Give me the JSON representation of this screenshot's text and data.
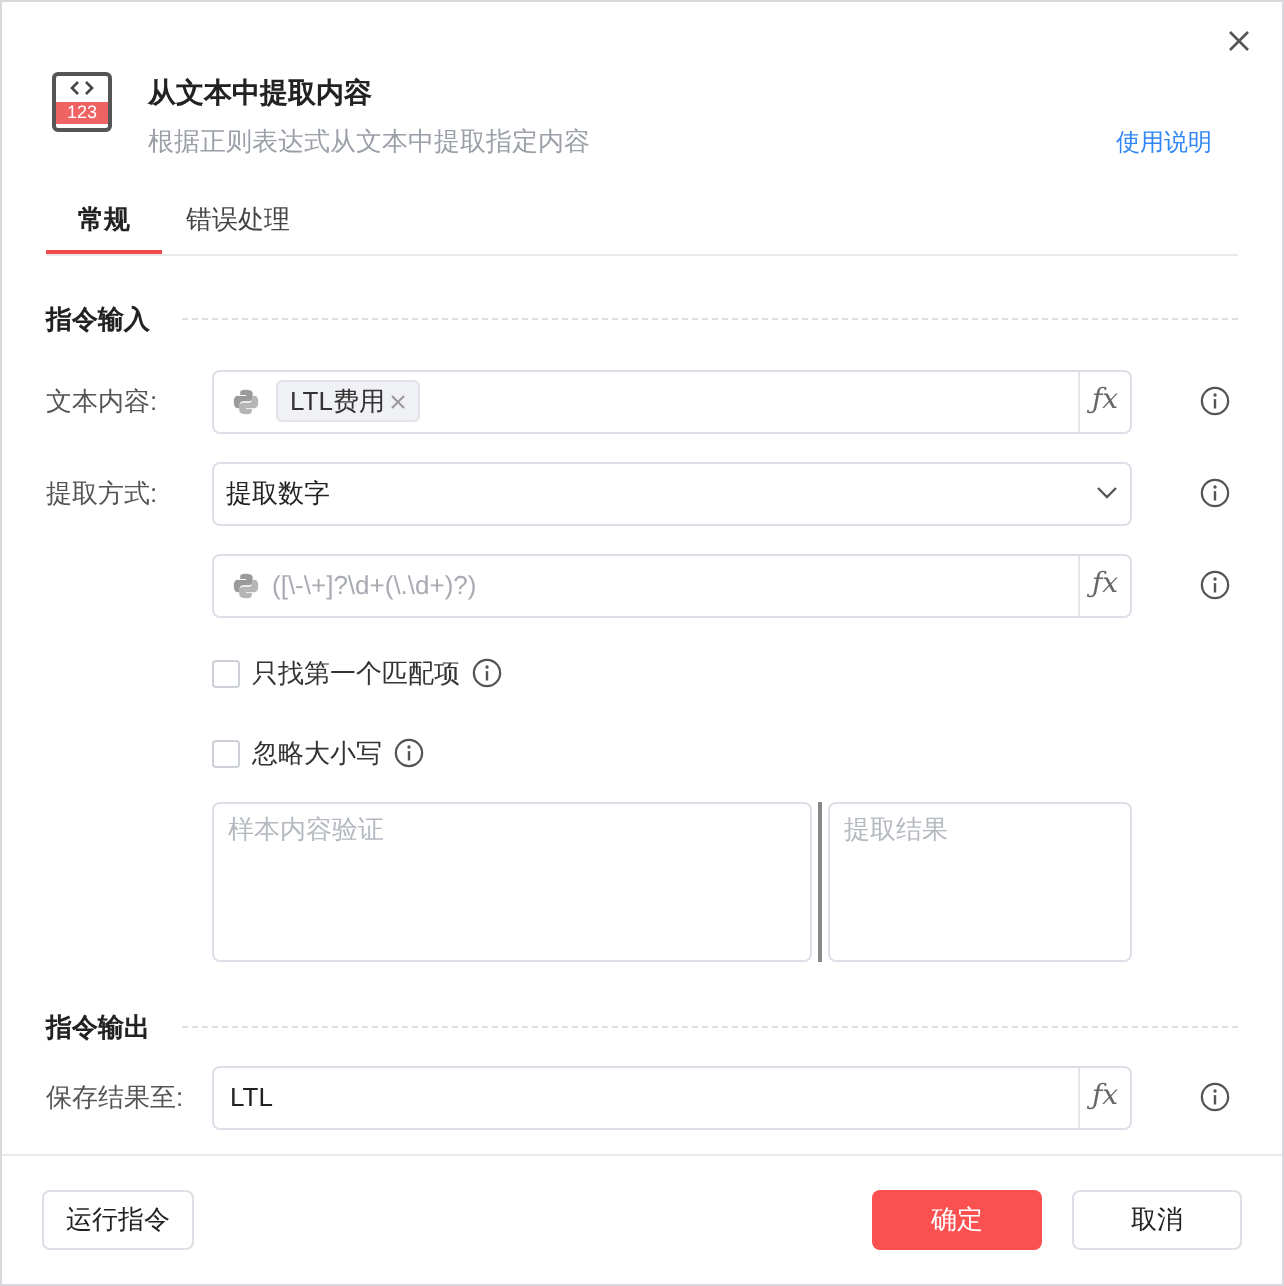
{
  "header": {
    "icon_text": "123",
    "title": "从文本中提取内容",
    "subtitle": "根据正则表达式从文本中提取指定内容",
    "help_link": "使用说明"
  },
  "tabs": [
    {
      "label": "常规",
      "selected": true
    },
    {
      "label": "错误处理",
      "selected": false
    }
  ],
  "input_section": {
    "heading": "指令输入",
    "rows": [
      {
        "kind": "tags",
        "label": "文本内容:",
        "tags": [
          "LTL费用"
        ],
        "fx": "ƒx"
      },
      {
        "kind": "select",
        "label": "提取方式:",
        "value": "提取数字"
      },
      {
        "kind": "python",
        "placeholder": "([\\-\\+]?\\d+(\\.\\d+)?)",
        "fx": "ƒx"
      }
    ],
    "checkboxes": [
      {
        "label": "只找第一个匹配项",
        "checked": false
      },
      {
        "label": "忽略大小写",
        "checked": false
      }
    ],
    "sample_placeholder": "样本内容验证",
    "result_placeholder": "提取结果"
  },
  "output_section": {
    "heading": "指令输出",
    "label": "保存结果至:",
    "value": "LTL",
    "fx": "ƒx"
  },
  "footer": {
    "run_button": "运行指令",
    "ok_button": "确定",
    "cancel_button": "取消"
  }
}
